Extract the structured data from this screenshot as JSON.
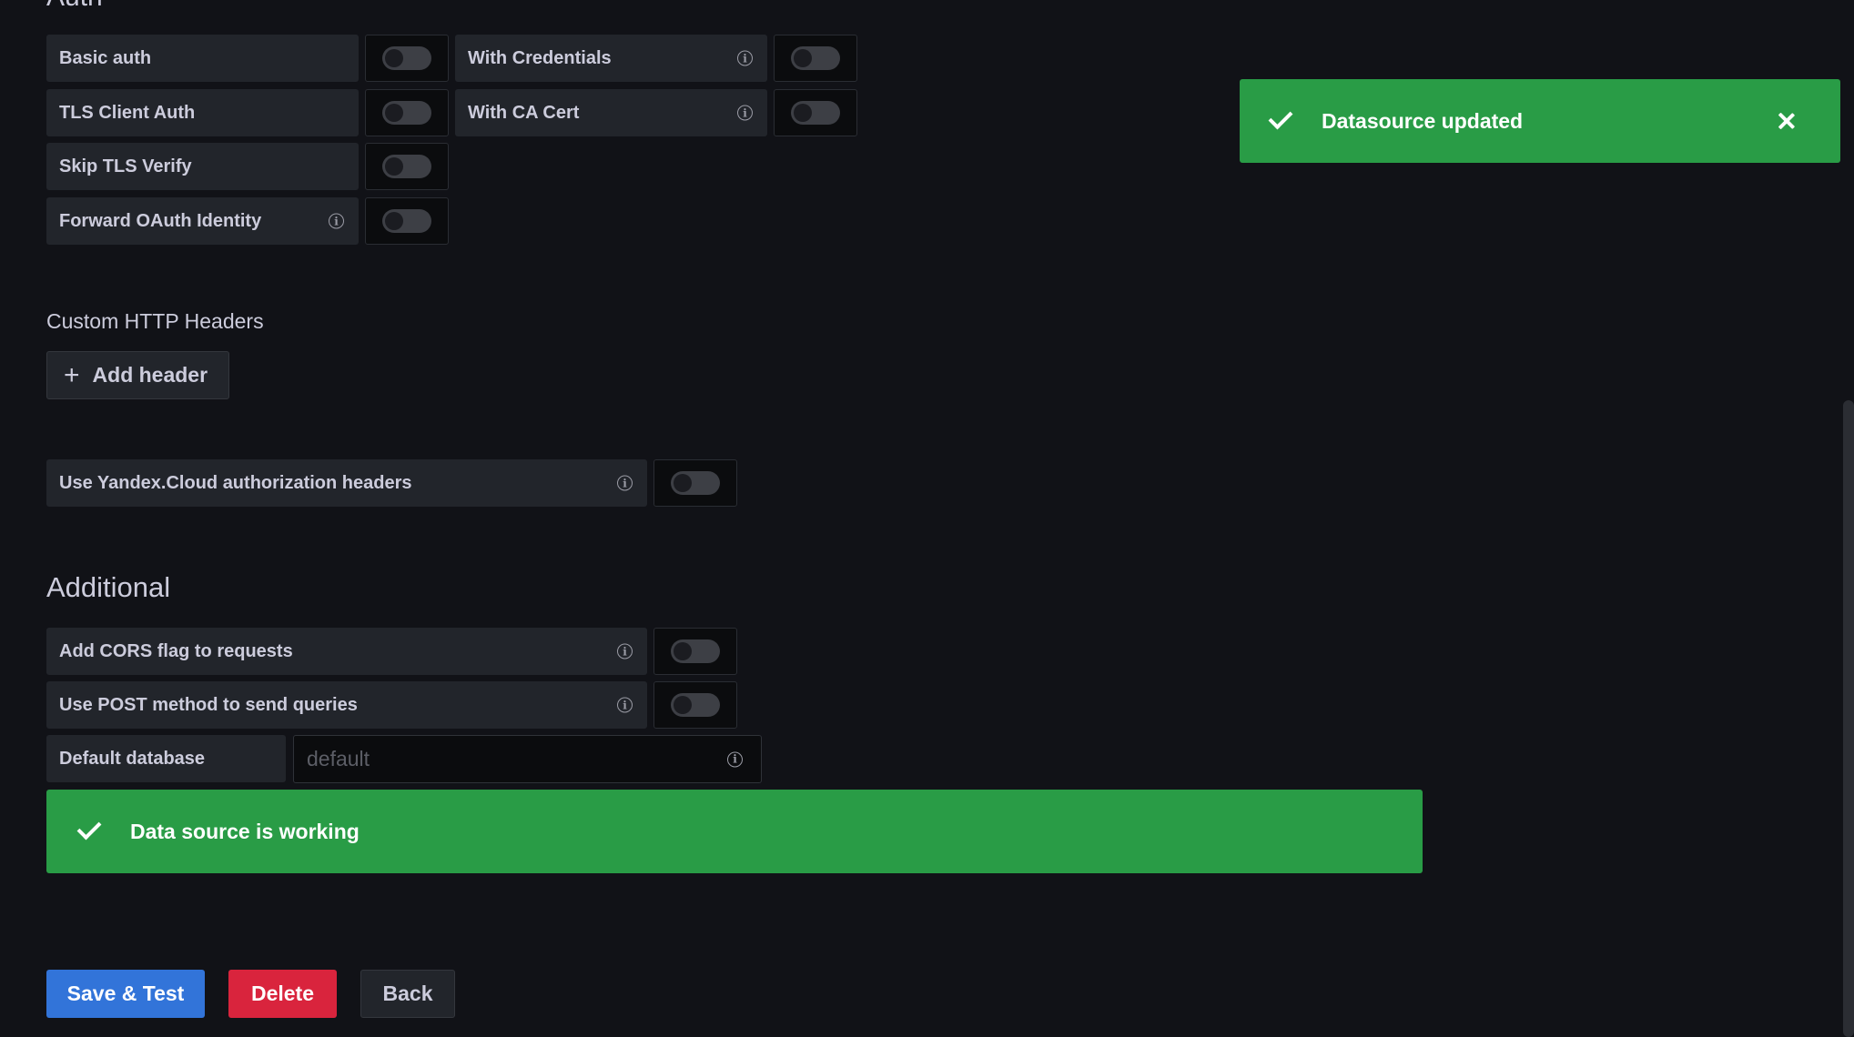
{
  "auth": {
    "title": "Auth",
    "rows": [
      {
        "label": "Basic auth"
      },
      {
        "label": "With Credentials"
      },
      {
        "label": "TLS Client Auth"
      },
      {
        "label": "With CA Cert"
      },
      {
        "label": "Skip TLS Verify"
      },
      {
        "label": "Forward OAuth Identity"
      }
    ]
  },
  "custom_headers": {
    "title": "Custom HTTP Headers",
    "add_label": "Add header"
  },
  "yandex": {
    "label": "Use Yandex.Cloud authorization headers"
  },
  "additional": {
    "title": "Additional",
    "cors_label": "Add CORS flag to requests",
    "post_label": "Use POST method to send queries",
    "db_label": "Default database",
    "db_placeholder": "default"
  },
  "status": {
    "message": "Data source is working"
  },
  "toast": {
    "message": "Datasource updated"
  },
  "actions": {
    "save_label": "Save & Test",
    "delete_label": "Delete",
    "back_label": "Back"
  },
  "colors": {
    "success": "#299c46",
    "primary": "#3274d9",
    "danger": "#d9243d",
    "background": "#111217"
  }
}
